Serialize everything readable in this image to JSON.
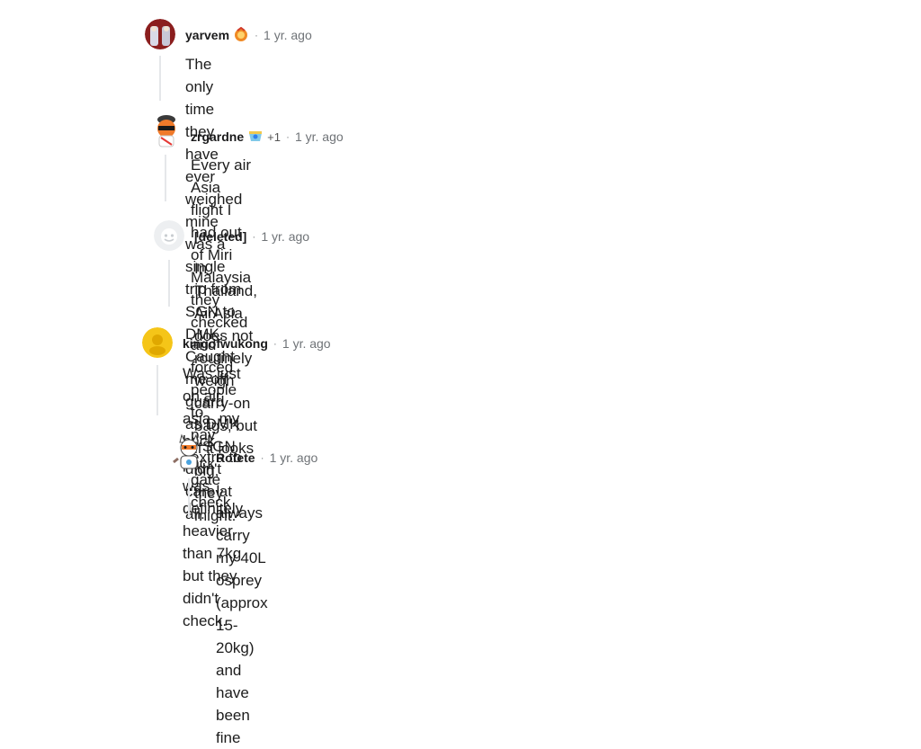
{
  "comments": [
    {
      "author": "yarvem",
      "time": "1 yr. ago",
      "body_line1": "The only time they have ever weighed mine was a single trip from SGN to DMK.",
      "body_line2": "Caught me off guard as DMK to SGN didn't care at all."
    },
    {
      "author": "zrgardne",
      "plus": "+1",
      "time": "1 yr. ago",
      "body_line1": "Every air Asia flight I had out of Miri Malaysia they checked and forced people to",
      "body_line2": "pay extra to gate check"
    },
    {
      "author": "[deleted]",
      "time": "1 yr. ago",
      "body_line1": "In Thailand, AirAsia does not routinely weigh carry-on bags, but if it looks big,",
      "body_line2": "they might."
    },
    {
      "author": "kingofwukong",
      "time": "1 yr. ago",
      "body_line1": "Was just on air asia, my back pack was definitely heavier than 7kg but they didn't",
      "body_line2": "check."
    },
    {
      "author": "Rofete",
      "time": "1 yr. ago",
      "body_line1": "I always carry my 40L osprey (approx 15-20kg) and have been fine"
    }
  ],
  "separator": "·",
  "colors": {
    "thread_line": "#e5e7ea",
    "meta_text": "#6f7377",
    "body_text": "#1c1c1c"
  }
}
